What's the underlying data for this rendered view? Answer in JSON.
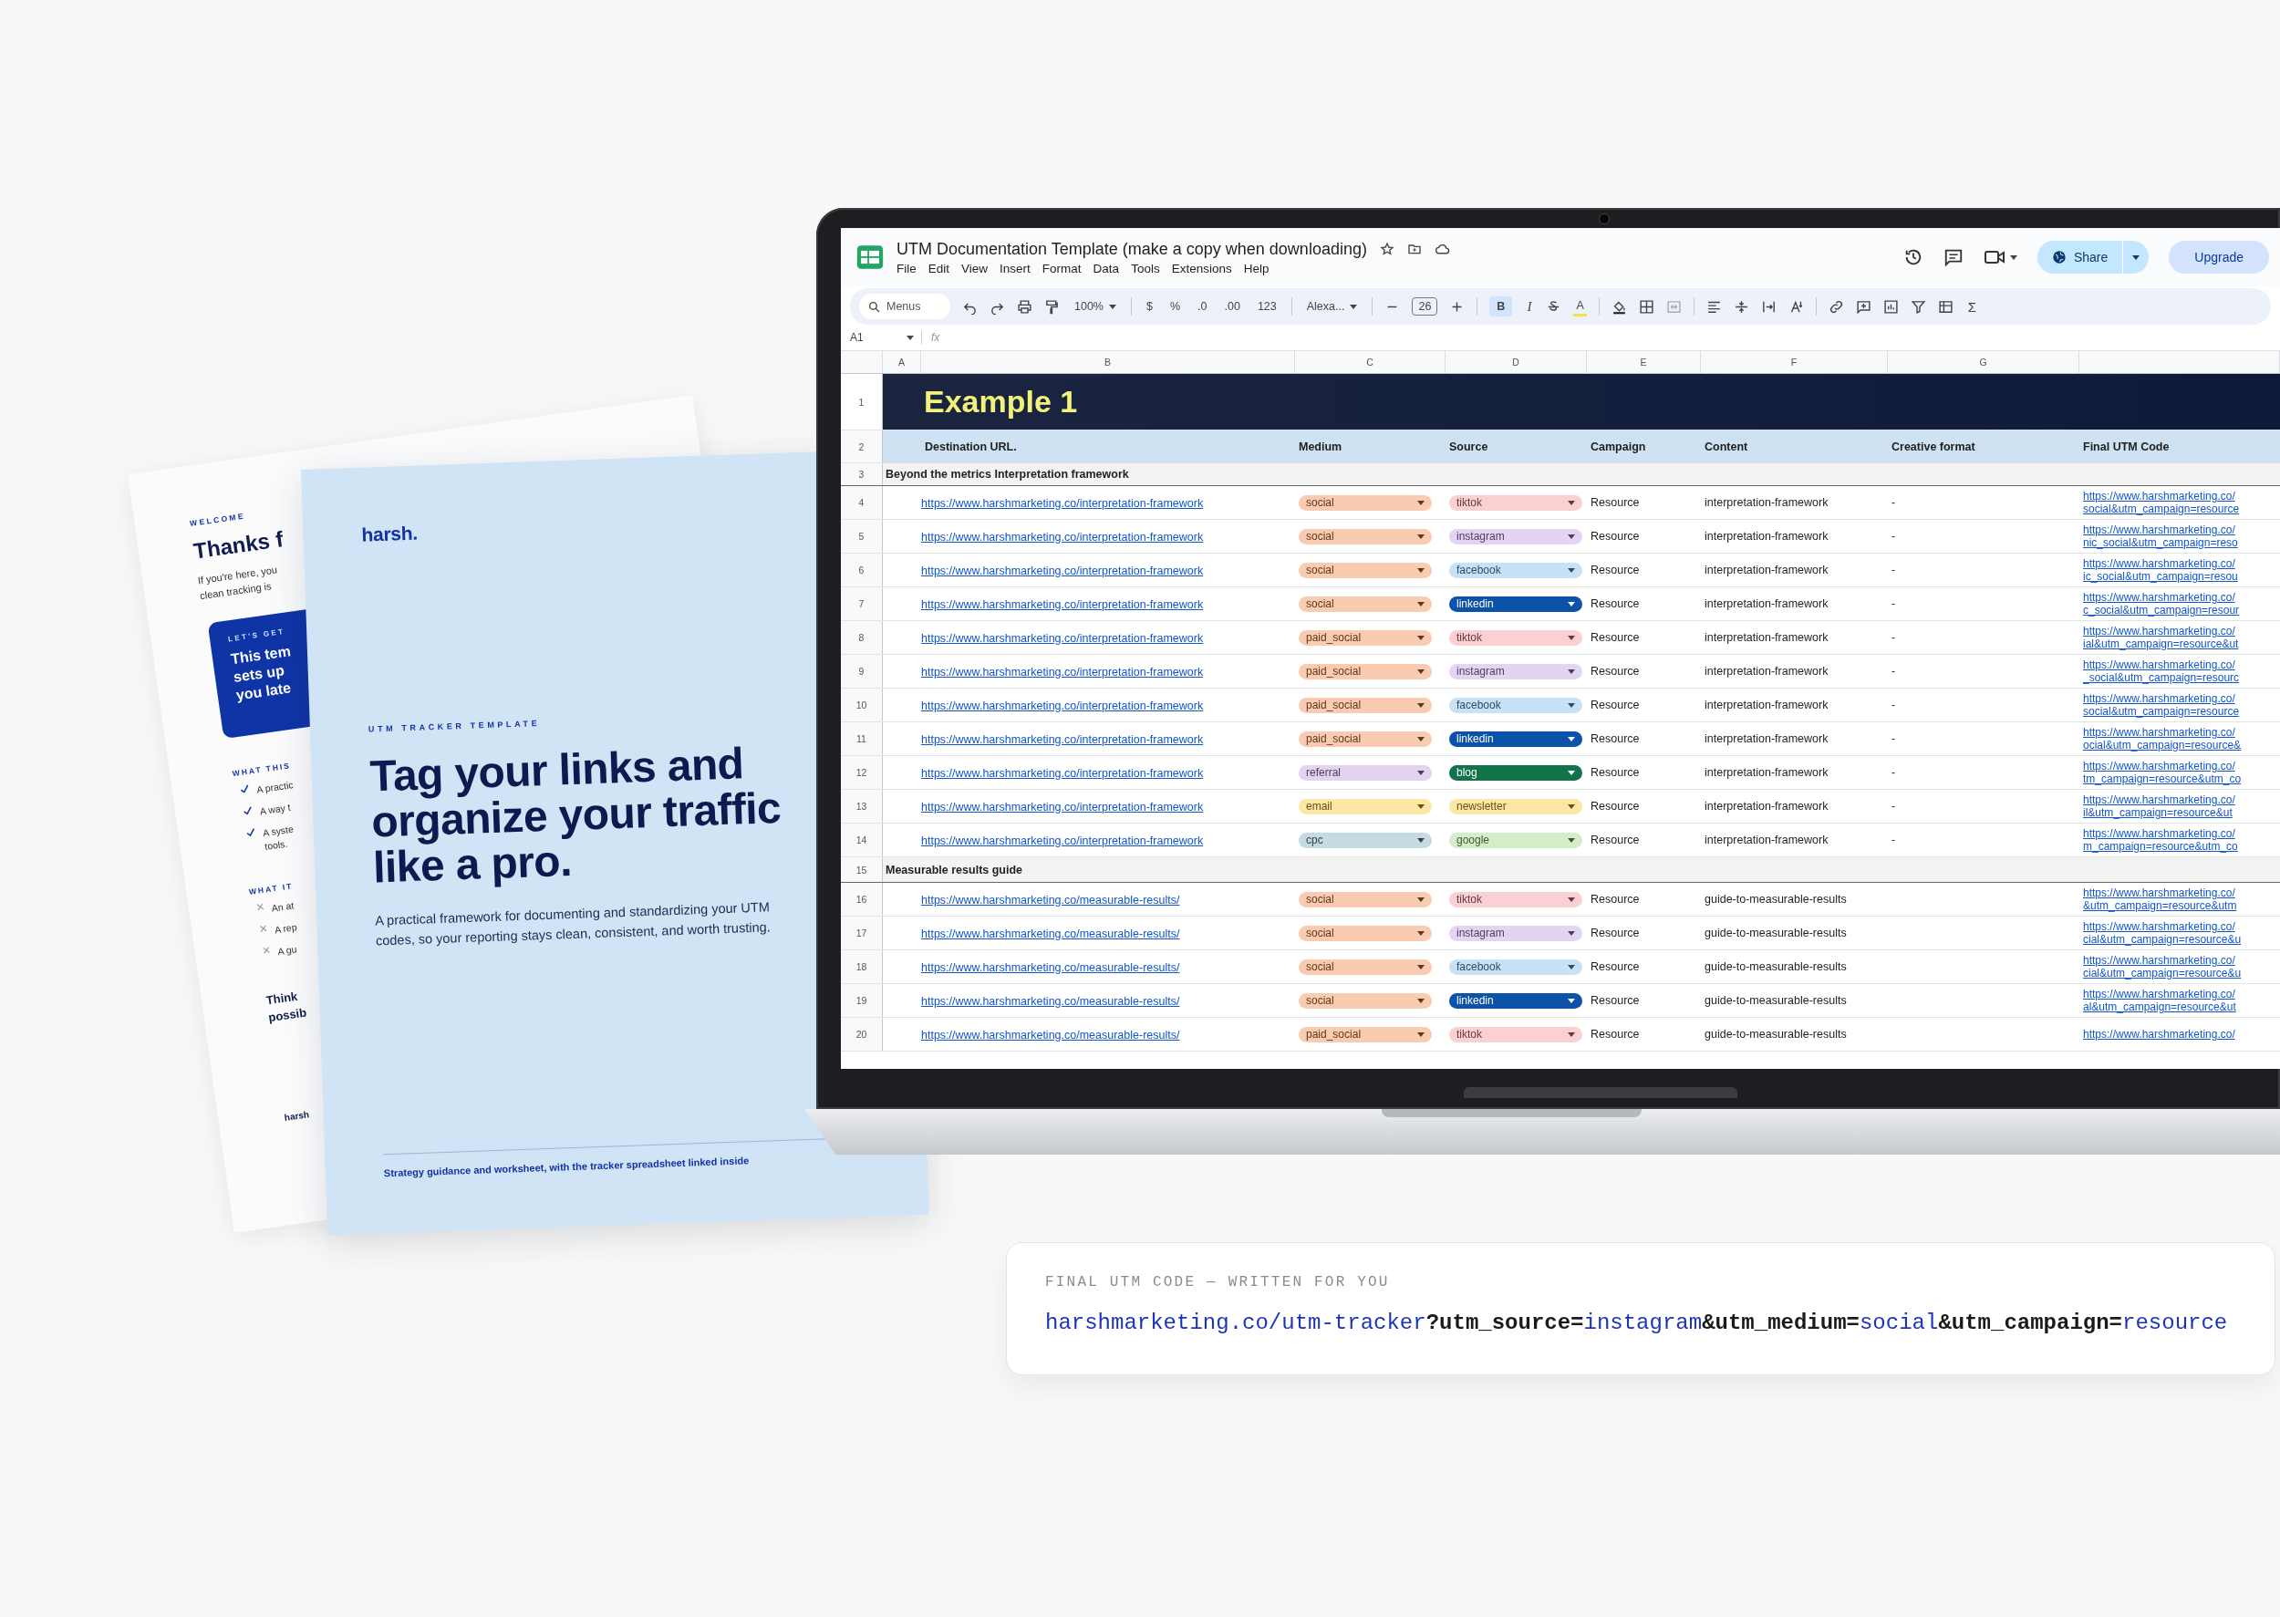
{
  "welcome_page": {
    "eyebrow": "WELCOME",
    "heading": "Thanks f",
    "intro_lines": [
      "If you're here, you",
      "clean tracking is"
    ],
    "callout": {
      "eyebrow": "LET'S GET",
      "lines": [
        "This tem",
        "sets up",
        "you late"
      ]
    },
    "lists": [
      {
        "title": "WHAT THIS",
        "kind": "check",
        "items": [
          {
            "lines": [
              "A practic"
            ]
          },
          {
            "lines": [
              "A way t"
            ]
          },
          {
            "lines": [
              "A syste",
              "tools."
            ]
          }
        ]
      },
      {
        "title": "WHAT IT",
        "kind": "cross",
        "items": [
          {
            "lines": [
              "An at"
            ]
          },
          {
            "lines": [
              "A rep"
            ]
          },
          {
            "lines": [
              "A gu"
            ]
          }
        ]
      }
    ],
    "closing_lines": [
      "Think",
      "possib"
    ],
    "footer": "harsh"
  },
  "cover": {
    "logo": "harsh.",
    "eyebrow": "UTM TRACKER TEMPLATE",
    "title": "Tag your links and organize your traffic like a pro.",
    "description": "A practical framework for documenting and standardizing your UTM codes, so your reporting stays clean, consistent, and worth trusting.",
    "footer": "Strategy guidance and worksheet, with the tracker spreadsheet linked inside"
  },
  "sheet": {
    "title": "UTM Documentation Template (make a copy when downloading)",
    "menus": [
      "File",
      "Edit",
      "View",
      "Insert",
      "Format",
      "Data",
      "Tools",
      "Extensions",
      "Help"
    ],
    "share_label": "Share",
    "upgrade_label": "Upgrade",
    "toolbar": {
      "search_placeholder": "Menus",
      "zoom": "100%",
      "currency": "$",
      "percent": "%",
      "decrease_decimals": ".0",
      "increase_decimals": ".00",
      "number_format": "123",
      "font": "Alexa...",
      "font_size": "26",
      "bold": {
        "label": "B",
        "on": true
      },
      "italic": "I",
      "text_color": "A",
      "functions": "Σ"
    },
    "name_box": "A1",
    "formula_label": "fx",
    "column_letters": [
      "A",
      "B",
      "C",
      "D",
      "E",
      "F",
      "G"
    ],
    "title_row": {
      "number": "1",
      "text": "Example 1"
    },
    "header_row": {
      "number": "2",
      "cells": [
        "Destination URL.",
        "Medium",
        "Source",
        "Campaign",
        "Content",
        "Creative format",
        "Final UTM Code"
      ]
    },
    "rows": [
      {
        "kind": "section",
        "number": "3",
        "text": "Beyond the metrics Interpretation framework"
      },
      {
        "kind": "entry",
        "number": "4",
        "url": "https://www.harshmarketing.co/interpretation-framework",
        "medium": {
          "text": "social",
          "color": "#f9cbb0"
        },
        "source": {
          "text": "tiktok",
          "color": "#fbd0d2"
        },
        "campaign": "Resource",
        "content": "interpretation-framework",
        "creative_format": "-",
        "utm_code": [
          "https://www.harshmarketing.co/",
          "social&utm_campaign=resource"
        ]
      },
      {
        "kind": "entry",
        "number": "5",
        "url": "https://www.harshmarketing.co/interpretation-framework",
        "medium": {
          "text": "social",
          "color": "#f9cbb0"
        },
        "source": {
          "text": "instagram",
          "color": "#e4d4f4"
        },
        "campaign": "Resource",
        "content": "interpretation-framework",
        "creative_format": "-",
        "utm_code": [
          "https://www.harshmarketing.co/",
          "nic_social&utm_campaign=reso"
        ]
      },
      {
        "kind": "entry",
        "number": "6",
        "url": "https://www.harshmarketing.co/interpretation-framework",
        "medium": {
          "text": "social",
          "color": "#f9cbb0"
        },
        "source": {
          "text": "facebook",
          "color": "#c7e2f6"
        },
        "campaign": "Resource",
        "content": "interpretation-framework",
        "creative_format": "-",
        "utm_code": [
          "https://www.harshmarketing.co/",
          "ic_social&utm_campaign=resou"
        ]
      },
      {
        "kind": "entry",
        "number": "7",
        "url": "https://www.harshmarketing.co/interpretation-framework",
        "medium": {
          "text": "social",
          "color": "#f9cbb0"
        },
        "source": {
          "text": "linkedin",
          "color": "#0a53a8"
        },
        "campaign": "Resource",
        "content": "interpretation-framework",
        "creative_format": "-",
        "utm_code": [
          "https://www.harshmarketing.co/",
          "c_social&utm_campaign=resour"
        ]
      },
      {
        "kind": "entry",
        "number": "8",
        "url": "https://www.harshmarketing.co/interpretation-framework",
        "medium": {
          "text": "paid_social",
          "color": "#f9cbb0"
        },
        "source": {
          "text": "tiktok",
          "color": "#fbd0d2"
        },
        "campaign": "Resource",
        "content": "interpretation-framework",
        "creative_format": "-",
        "utm_code": [
          "https://www.harshmarketing.co/",
          "ial&utm_campaign=resource&ut"
        ]
      },
      {
        "kind": "entry",
        "number": "9",
        "url": "https://www.harshmarketing.co/interpretation-framework",
        "medium": {
          "text": "paid_social",
          "color": "#f9cbb0"
        },
        "source": {
          "text": "instagram",
          "color": "#e4d4f4"
        },
        "campaign": "Resource",
        "content": "interpretation-framework",
        "creative_format": "-",
        "utm_code": [
          "https://www.harshmarketing.co/",
          "_social&utm_campaign=resourc"
        ]
      },
      {
        "kind": "entry",
        "number": "10",
        "url": "https://www.harshmarketing.co/interpretation-framework",
        "medium": {
          "text": "paid_social",
          "color": "#f9cbb0"
        },
        "source": {
          "text": "facebook",
          "color": "#c7e2f6"
        },
        "campaign": "Resource",
        "content": "interpretation-framework",
        "creative_format": "-",
        "utm_code": [
          "https://www.harshmarketing.co/",
          "social&utm_campaign=resource"
        ]
      },
      {
        "kind": "entry",
        "number": "11",
        "url": "https://www.harshmarketing.co/interpretation-framework",
        "medium": {
          "text": "paid_social",
          "color": "#f9cbb0"
        },
        "source": {
          "text": "linkedin",
          "color": "#0a53a8"
        },
        "campaign": "Resource",
        "content": "interpretation-framework",
        "creative_format": "-",
        "utm_code": [
          "https://www.harshmarketing.co/",
          "ocial&utm_campaign=resource&"
        ]
      },
      {
        "kind": "entry",
        "number": "12",
        "url": "https://www.harshmarketing.co/interpretation-framework",
        "medium": {
          "text": "referral",
          "color": "#e3d2f1"
        },
        "source": {
          "text": "blog",
          "color": "#11734b"
        },
        "campaign": "Resource",
        "content": "interpretation-framework",
        "creative_format": "-",
        "utm_code": [
          "https://www.harshmarketing.co/",
          "tm_campaign=resource&utm_co"
        ]
      },
      {
        "kind": "entry",
        "number": "13",
        "url": "https://www.harshmarketing.co/interpretation-framework",
        "medium": {
          "text": "email",
          "color": "#fde7a5"
        },
        "source": {
          "text": "newsletter",
          "color": "#fde7a5"
        },
        "campaign": "Resource",
        "content": "interpretation-framework",
        "creative_format": "-",
        "utm_code": [
          "https://www.harshmarketing.co/",
          "il&utm_campaign=resource&ut"
        ]
      },
      {
        "kind": "entry",
        "number": "14",
        "url": "https://www.harshmarketing.co/interpretation-framework",
        "medium": {
          "text": "cpc",
          "color": "#c6dae3"
        },
        "source": {
          "text": "google",
          "color": "#d3eec8"
        },
        "campaign": "Resource",
        "content": "interpretation-framework",
        "creative_format": "-",
        "utm_code": [
          "https://www.harshmarketing.co/",
          "m_campaign=resource&utm_co"
        ]
      },
      {
        "kind": "section",
        "number": "15",
        "text": "Measurable results guide"
      },
      {
        "kind": "entry",
        "number": "16",
        "url": "https://www.harshmarketing.co/measurable-results/",
        "medium": {
          "text": "social",
          "color": "#f9cbb0"
        },
        "source": {
          "text": "tiktok",
          "color": "#fbd0d2"
        },
        "campaign": "Resource",
        "content": "guide-to-measurable-results",
        "utm_code": [
          "https://www.harshmarketing.co/",
          "&utm_campaign=resource&utm"
        ]
      },
      {
        "kind": "entry",
        "number": "17",
        "url": "https://www.harshmarketing.co/measurable-results/",
        "medium": {
          "text": "social",
          "color": "#f9cbb0"
        },
        "source": {
          "text": "instagram",
          "color": "#e4d4f4"
        },
        "campaign": "Resource",
        "content": "guide-to-measurable-results",
        "utm_code": [
          "https://www.harshmarketing.co/",
          "cial&utm_campaign=resource&u"
        ]
      },
      {
        "kind": "entry",
        "number": "18",
        "url": "https://www.harshmarketing.co/measurable-results/",
        "medium": {
          "text": "social",
          "color": "#f9cbb0"
        },
        "source": {
          "text": "facebook",
          "color": "#c7e2f6"
        },
        "campaign": "Resource",
        "content": "guide-to-measurable-results",
        "utm_code": [
          "https://www.harshmarketing.co/",
          "cial&utm_campaign=resource&u"
        ]
      },
      {
        "kind": "entry",
        "number": "19",
        "url": "https://www.harshmarketing.co/measurable-results/",
        "medium": {
          "text": "social",
          "color": "#f9cbb0"
        },
        "source": {
          "text": "linkedin",
          "color": "#0a53a8"
        },
        "campaign": "Resource",
        "content": "guide-to-measurable-results",
        "utm_code": [
          "https://www.harshmarketing.co/",
          "al&utm_campaign=resource&ut"
        ]
      },
      {
        "kind": "entry",
        "number": "20",
        "url": "https://www.harshmarketing.co/measurable-results/",
        "medium": {
          "text": "paid_social",
          "color": "#f9cbb0"
        },
        "source": {
          "text": "tiktok",
          "color": "#fbd0d2"
        },
        "campaign": "Resource",
        "content": "guide-to-measurable-results",
        "utm_code": [
          "https://www.harshmarketing.co/"
        ]
      }
    ]
  },
  "utm_card": {
    "label": "FINAL UTM CODE — WRITTEN FOR YOU",
    "code_parts": [
      {
        "kind": "value",
        "text": "harshmarketing.co/utm-tracker"
      },
      {
        "kind": "param",
        "text": "?utm_source="
      },
      {
        "kind": "value",
        "text": "instagram"
      },
      {
        "kind": "param",
        "text": "&utm_medium="
      },
      {
        "kind": "value",
        "text": "social"
      },
      {
        "kind": "param",
        "text": "&utm_campaign="
      },
      {
        "kind": "value",
        "text": "resource"
      }
    ]
  }
}
